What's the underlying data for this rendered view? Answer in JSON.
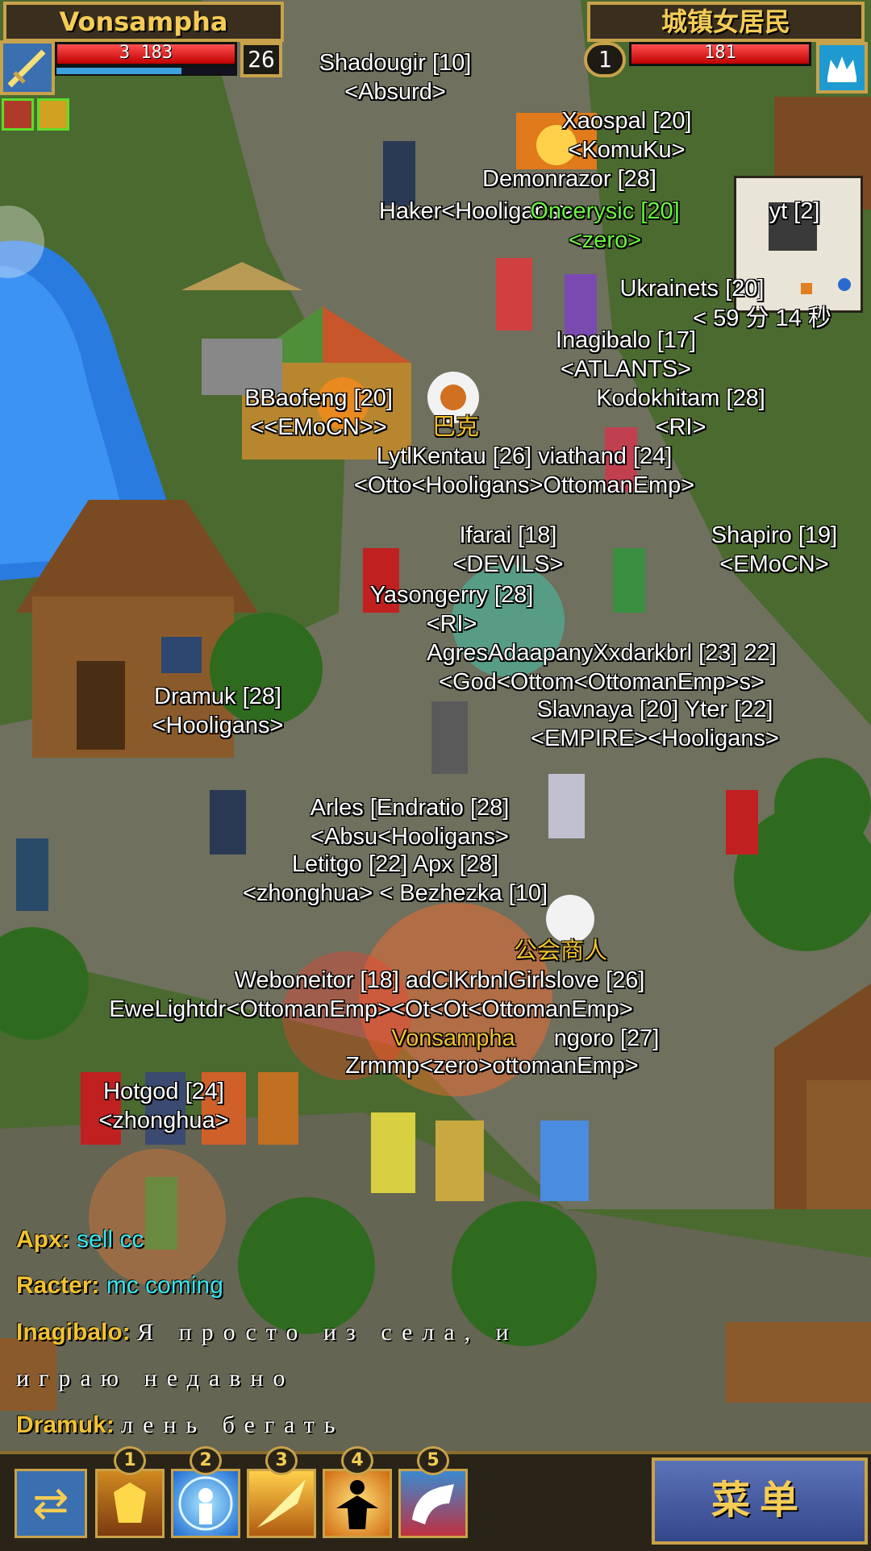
{
  "player": {
    "name": "Vonsampha",
    "hp_text": "3 183",
    "hp_fraction": 1.0,
    "mp_fraction": 0.7,
    "level": "26"
  },
  "target": {
    "name": "城镇女居民",
    "level": "1",
    "hp_text": "181",
    "hp_fraction": 1.0
  },
  "labels": [
    {
      "name": "Shadougir [10]",
      "guild": "<Absurd>"
    },
    {
      "name": "Xaospal [20]",
      "guild": "<KomuKu>"
    },
    {
      "name": "Demonrazor [28]",
      "guild": ""
    },
    {
      "name": "Haker<Hooligans>",
      "guild": ""
    },
    {
      "name": "Oncerysic [20]",
      "guild": "<zero>",
      "color": "green"
    },
    {
      "name": "yt [2]",
      "guild": ""
    },
    {
      "name": "Ukrainets [20]",
      "guild": ""
    },
    {
      "name": "< 59 分 14 秒",
      "guild": ""
    },
    {
      "name": "Inagibalo [17]",
      "guild": "<ATLANTS>"
    },
    {
      "name": "Kodokhitam [28]",
      "guild": "<RI>"
    },
    {
      "name": "BBaofeng [20]",
      "guild": "<<EMoCN>>"
    },
    {
      "name": "巴克",
      "guild": "",
      "color": "gold"
    },
    {
      "name": "LytlKentau [26] viathand [24]",
      "guild": "<Otto<Hooligans>OttomanEmp>"
    },
    {
      "name": "Ifarai [18]",
      "guild": "<DEVILS>"
    },
    {
      "name": "Shapiro [19]",
      "guild": "<EMoCN>"
    },
    {
      "name": "Yasongerry [28]",
      "guild": "<RI>"
    },
    {
      "name": "AgresAdaapanyXxdarkbrl [23] 22]",
      "guild": "<God<Ottom<OttomanEmp>s>"
    },
    {
      "name": "Dramuk [28]",
      "guild": "<Hooligans>"
    },
    {
      "name": "Slavnaya [20] Yter [22]",
      "guild": "<EMPIRE><Hooligans>"
    },
    {
      "name": "Arles [Endratio [28]",
      "guild": "<Absu<Hooligans>"
    },
    {
      "name": "Letitgo [22]  Apx [28]",
      "guild": "<zhonghua> < Bezhezka [10]"
    },
    {
      "name": "公会商人",
      "guild": "",
      "color": "gold"
    },
    {
      "name": "Weboneitor [18] adClKrbnlGirlslove [26]",
      "guild": ""
    },
    {
      "name": "EweLightdr<OttomanEmp><Ot<Ot<OttomanEmp>",
      "guild": ""
    },
    {
      "name": "Vonsampha",
      "guild": "",
      "color": "gold"
    },
    {
      "name": "ngoro [27]",
      "guild": ""
    },
    {
      "name": "Zrmmp<zero>ottomanEmp>",
      "guild": ""
    },
    {
      "name": "Hotgod [24]",
      "guild": "<zhonghua>"
    }
  ],
  "chat": [
    {
      "who": "Apx:",
      "msg": "sell cc",
      "style": "cyan"
    },
    {
      "who": "Racter:",
      "msg": "mc coming",
      "style": "cyan"
    },
    {
      "who": "Inagibalo:",
      "msg": "Я просто из села, и",
      "style": "white"
    },
    {
      "who": "",
      "msg": "играю недавно",
      "style": "white"
    },
    {
      "who": "Dramuk:",
      "msg": "лень бегать",
      "style": "white"
    }
  ],
  "skills": [
    "1",
    "2",
    "3",
    "4",
    "5"
  ],
  "menu_label": "菜单",
  "colors": {
    "accent": "#c8a24a",
    "hp": "#e02020",
    "mp": "#3fa0e0",
    "gold_text": "#f2c232",
    "chat_cyan": "#38e6f0"
  }
}
